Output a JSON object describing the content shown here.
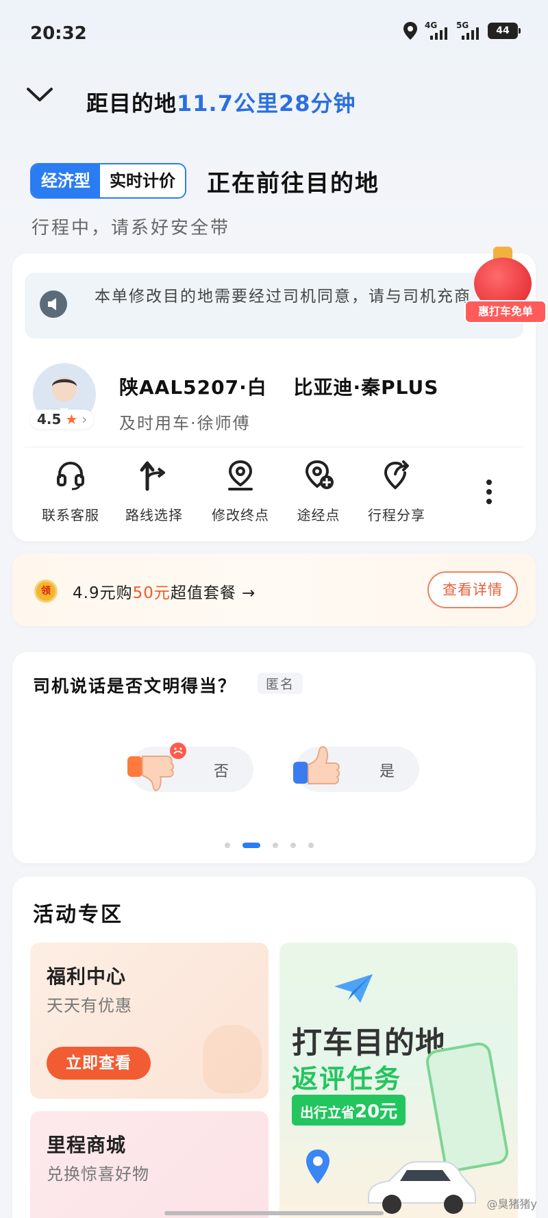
{
  "status_bar": {
    "time": "20:32",
    "net1": "4G",
    "net2": "5G",
    "battery": "44"
  },
  "header": {
    "prefix": "距目的地",
    "distance": "11.7公里",
    "duration": "28分钟"
  },
  "trip": {
    "tag_type": "经济型",
    "tag_pricing": "实时计价",
    "status": "正在前往目的地",
    "subtitle": "行程中，请系好安全带"
  },
  "notice": {
    "text": "本单修改目的地需要经过司机同意，请与司机充商",
    "lantern_label": "惠打车免单"
  },
  "driver": {
    "rating": "4.5",
    "plate": "陕AAL5207·白",
    "car_model": "比亚迪·秦PLUS",
    "service": "及时用车·徐师傅"
  },
  "actions": [
    {
      "label": "联系客服",
      "icon": "headset-icon"
    },
    {
      "label": "路线选择",
      "icon": "route-icon"
    },
    {
      "label": "修改终点",
      "icon": "location-pin-icon"
    },
    {
      "label": "途经点",
      "icon": "add-waypoint-icon"
    },
    {
      "label": "行程分享",
      "icon": "share-trip-icon"
    }
  ],
  "promo": {
    "coin_label": "领",
    "text_before": "4.9元购",
    "text_highlight": "50元",
    "text_after": "超值套餐 →",
    "button": "查看详情"
  },
  "survey": {
    "question": "司机说话是否文明得当？",
    "anonymous": "匿名",
    "no_label": "否",
    "yes_label": "是",
    "pages": 5,
    "active_page": 2
  },
  "activity": {
    "title": "活动专区",
    "welfare": {
      "title": "福利中心",
      "subtitle": "天天有优惠",
      "button": "立即查看"
    },
    "mileage": {
      "title": "里程商城",
      "subtitle": "兑换惊喜好物"
    },
    "banner": {
      "line1": "打车目的地",
      "line2": "返评任务",
      "badge_prefix": "出行立省",
      "badge_amount": "20元"
    }
  },
  "watermark": "@臭猪猪y",
  "colors": {
    "accent": "#2b7cf3",
    "orange": "#f25c33",
    "green": "#22c55e"
  }
}
